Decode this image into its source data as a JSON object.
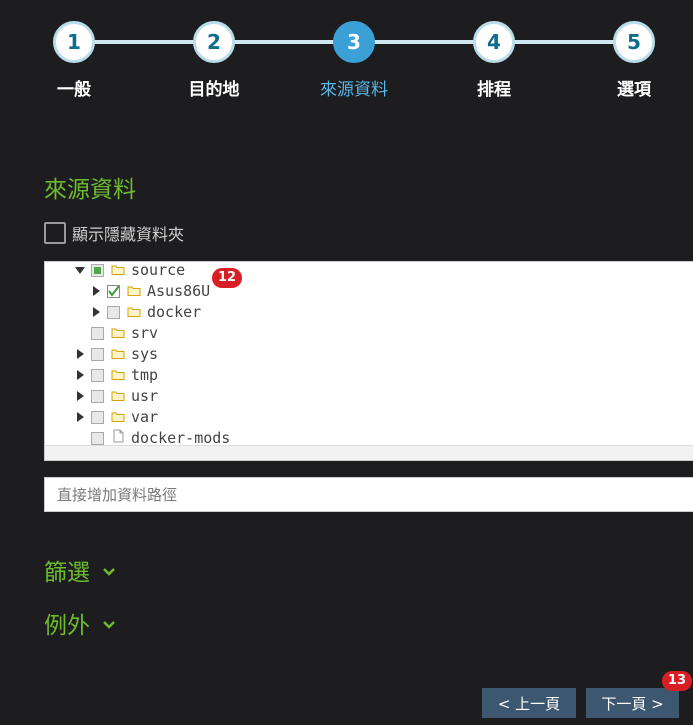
{
  "steps": [
    {
      "number": "1",
      "label": "一般"
    },
    {
      "number": "2",
      "label": "目的地"
    },
    {
      "number": "3",
      "label": "來源資料"
    },
    {
      "number": "4",
      "label": "排程"
    },
    {
      "number": "5",
      "label": "選項"
    }
  ],
  "active_step": 3,
  "section_title": "來源資料",
  "show_hidden_label": "顯示隱藏資料夾",
  "tree": {
    "items": [
      {
        "name": "source",
        "state": "partial",
        "expanded": true,
        "type": "folder"
      },
      {
        "name": "Asus86U",
        "state": "checked",
        "expanded": false,
        "type": "folder"
      },
      {
        "name": "docker",
        "state": "unchecked",
        "expanded": false,
        "type": "folder"
      },
      {
        "name": "srv",
        "state": "unchecked",
        "type": "folder"
      },
      {
        "name": "sys",
        "state": "unchecked",
        "expanded": false,
        "type": "folder"
      },
      {
        "name": "tmp",
        "state": "unchecked",
        "expanded": false,
        "type": "folder"
      },
      {
        "name": "usr",
        "state": "unchecked",
        "expanded": false,
        "type": "folder"
      },
      {
        "name": "var",
        "state": "unchecked",
        "expanded": false,
        "type": "folder"
      },
      {
        "name": "docker-mods",
        "state": "unchecked",
        "type": "file"
      }
    ]
  },
  "badges": {
    "tree": "12",
    "next": "13"
  },
  "path_input": {
    "placeholder": "直接增加資料路徑"
  },
  "filter_label": "篩選",
  "exception_label": "例外",
  "buttons": {
    "prev": "< 上一頁",
    "next": "下一頁 >"
  },
  "colors": {
    "accent_green": "#6dbb2f",
    "step_active": "#3aa0d5",
    "badge": "#d81f26",
    "button": "#3d5770"
  }
}
